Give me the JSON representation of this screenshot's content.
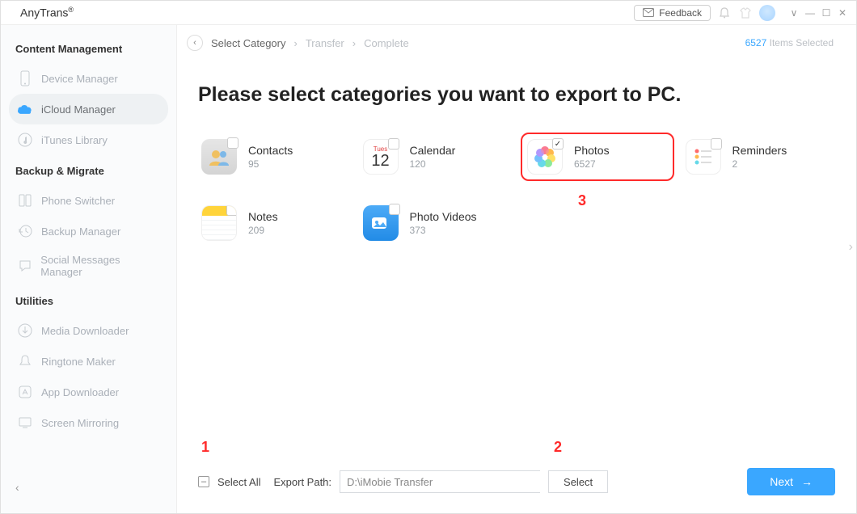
{
  "app": {
    "title": "AnyTrans",
    "trademark": "®"
  },
  "titlebar": {
    "feedback_label": "Feedback",
    "win": {
      "dropdown": "∨",
      "minimize": "—",
      "maximize": "☐",
      "close": "✕"
    }
  },
  "sidebar": {
    "sections": {
      "content": {
        "title": "Content Management"
      },
      "backup": {
        "title": "Backup & Migrate"
      },
      "utilities": {
        "title": "Utilities"
      }
    },
    "items": {
      "device_manager": "Device Manager",
      "icloud_manager": "iCloud Manager",
      "itunes_library": "iTunes Library",
      "phone_switcher": "Phone Switcher",
      "backup_manager": "Backup Manager",
      "social_messages": "Social Messages Manager",
      "media_downloader": "Media Downloader",
      "ringtone_maker": "Ringtone Maker",
      "app_downloader": "App Downloader",
      "screen_mirroring": "Screen Mirroring"
    },
    "collapse": "‹"
  },
  "breadcrumb": {
    "back": "‹",
    "step1": "Select Category",
    "sep": "›",
    "step2": "Transfer",
    "step3": "Complete"
  },
  "status": {
    "count": "6527",
    "label": "Items Selected"
  },
  "heading": "Please select categories you want to export to PC.",
  "categories": {
    "contacts": {
      "name": "Contacts",
      "count": "95",
      "checked": "",
      "icon": "contacts"
    },
    "calendar": {
      "name": "Calendar",
      "count": "120",
      "checked": "",
      "icon": "calendar",
      "day_label": "Tues",
      "day_num": "12"
    },
    "photos": {
      "name": "Photos",
      "count": "6527",
      "checked": "✓",
      "icon": "photos"
    },
    "reminders": {
      "name": "Reminders",
      "count": "2",
      "checked": "",
      "icon": "reminders"
    },
    "notes": {
      "name": "Notes",
      "count": "209",
      "checked": "",
      "icon": "notes"
    },
    "photovid": {
      "name": "Photo Videos",
      "count": "373",
      "checked": "",
      "icon": "photo-videos"
    }
  },
  "annotations": {
    "a1": "1",
    "a2": "2",
    "a3": "3"
  },
  "footer": {
    "select_all_mark": "–",
    "select_all_label": "Select All",
    "export_path_label": "Export Path:",
    "path_value": "D:\\iMobie Transfer",
    "select_btn": "Select",
    "next_btn": "Next",
    "next_arrow": "→"
  }
}
